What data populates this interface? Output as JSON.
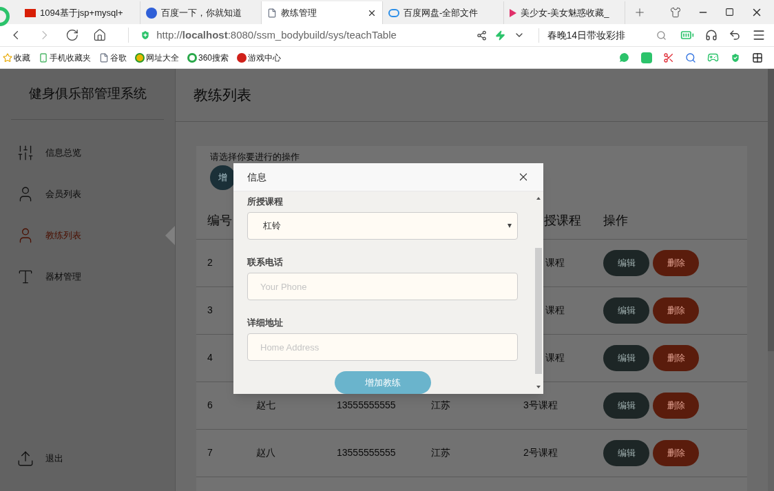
{
  "browser": {
    "tabs": [
      {
        "label": "1094基于jsp+mysql+",
        "selected": false,
        "closable": false
      },
      {
        "label": "百度一下，你就知道",
        "selected": false,
        "closable": false
      },
      {
        "label": "教练管理",
        "selected": true,
        "closable": true
      },
      {
        "label": "百度网盘-全部文件",
        "selected": false,
        "closable": false
      },
      {
        "label": "美少女-美女魅惑收藏_",
        "selected": false,
        "closable": false
      }
    ],
    "url": "http://**localhost**:8080/ssm_bodybuild/sys/teachTable",
    "search": {
      "value": "春晚14日带妆彩排"
    },
    "bookmarks": [
      {
        "label": "收藏"
      },
      {
        "label": "手机收藏夹"
      },
      {
        "label": "谷歌"
      },
      {
        "label": "网址大全"
      },
      {
        "label": "360搜索"
      },
      {
        "label": "游戏中心"
      }
    ]
  },
  "sidebar": {
    "title": "健身俱乐部管理系统",
    "items": [
      {
        "label": "信息总览",
        "selected": false,
        "kind": "sliders"
      },
      {
        "label": "会员列表",
        "selected": false,
        "kind": "person"
      },
      {
        "label": "教练列表",
        "selected": true,
        "kind": "person"
      },
      {
        "label": "器材管理",
        "selected": false,
        "kind": "text"
      }
    ],
    "logout": "退出"
  },
  "page": {
    "title": "教练列表",
    "hint": "请选择你要进行的操作",
    "add_button": "增",
    "table": {
      "columns": {
        "id": "编号",
        "course": "授课程",
        "actions": "操作"
      },
      "rows": [
        {
          "id": "2",
          "course": "课程",
          "edit": "编辑",
          "delete": "删除"
        },
        {
          "id": "3",
          "course": "课程",
          "edit": "编辑",
          "delete": "删除"
        },
        {
          "id": "4",
          "course": "课程",
          "edit": "编辑",
          "delete": "删除"
        },
        {
          "id": "6",
          "name": "赵七",
          "phone": "13555555555",
          "address": "江苏",
          "course": "3号课程",
          "edit": "编辑",
          "delete": "删除"
        },
        {
          "id": "7",
          "name": "赵八",
          "phone": "13555555555",
          "address": "江苏",
          "course": "2号课程",
          "edit": "编辑",
          "delete": "删除"
        }
      ]
    }
  },
  "dialog": {
    "title": "信息",
    "fields": [
      {
        "label": "所授课程",
        "kind": "select",
        "value": "杠铃"
      },
      {
        "label": "联系电话",
        "kind": "input",
        "placeholder": "Your Phone"
      },
      {
        "label": "详细地址",
        "kind": "input",
        "placeholder": "Home Address"
      }
    ],
    "submit": "增加教练"
  }
}
